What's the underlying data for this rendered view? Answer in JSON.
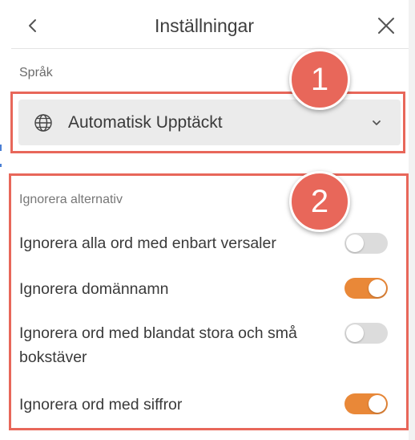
{
  "header": {
    "title": "Inställningar"
  },
  "language": {
    "section_label": "Språk",
    "selected": "Automatisk Upptäckt",
    "badge": "1"
  },
  "ignore": {
    "section_label": "Ignorera alternativ",
    "badge": "2",
    "options": [
      {
        "label": "Ignorera alla ord med enbart versaler",
        "enabled": false
      },
      {
        "label": "Ignorera domännamn",
        "enabled": true
      },
      {
        "label": "Ignorera ord med blandat stora och små bokstäver",
        "enabled": false
      },
      {
        "label": "Ignorera ord med siffror",
        "enabled": true
      }
    ]
  },
  "colors": {
    "annotation": "#e8675a",
    "toggle_on": "#e98838",
    "toggle_off": "#dcdcdc"
  }
}
